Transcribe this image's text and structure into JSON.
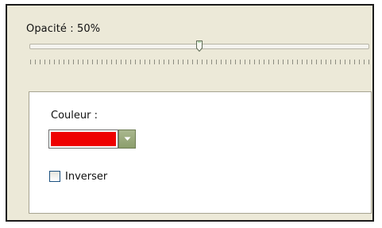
{
  "opacity": {
    "label": "Opacité : 50%",
    "value_percent": 50
  },
  "color_group": {
    "label": "Couleur :",
    "selected_color": "#EE0000",
    "dropdown_icon": "chevron-down-icon"
  },
  "invert": {
    "label": "Inverser",
    "checked": false
  },
  "theme": {
    "dialog_bg": "#ECE9D8",
    "group_bg": "#FFFFFF",
    "dropdown_button": "#98A979"
  }
}
